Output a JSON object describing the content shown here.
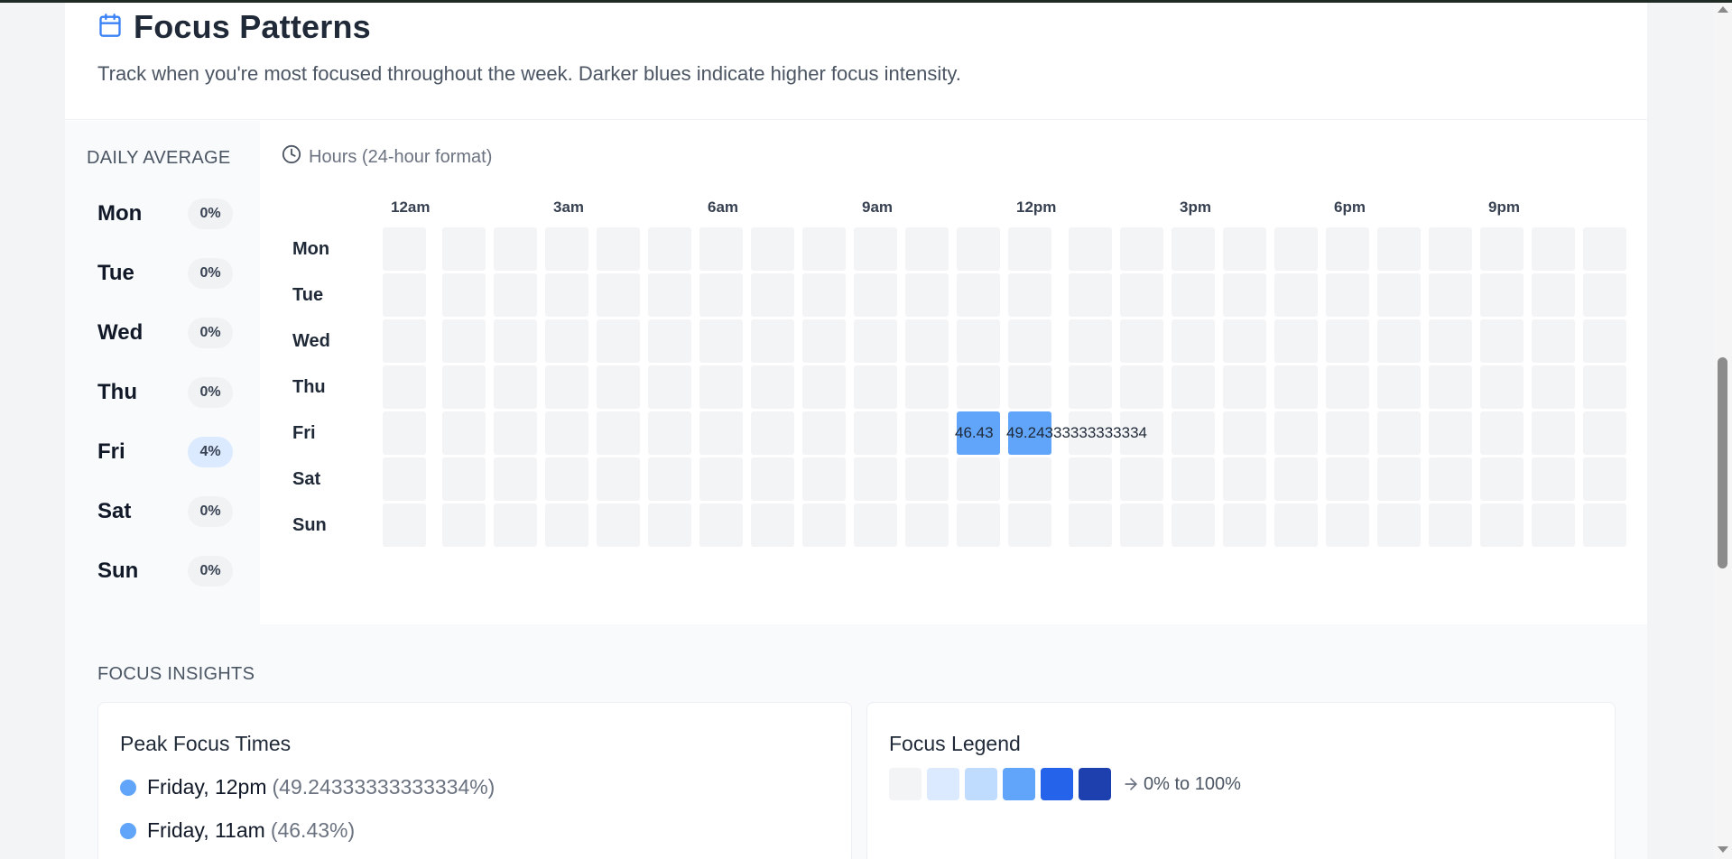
{
  "header": {
    "title": "Focus Patterns",
    "subtitle": "Track when you're most focused throughout the week. Darker blues indicate higher focus intensity.",
    "icon": "calendar-icon"
  },
  "sidebar": {
    "heading": "DAILY AVERAGE",
    "days": [
      {
        "name": "Mon",
        "pct": "0%"
      },
      {
        "name": "Tue",
        "pct": "0%"
      },
      {
        "name": "Wed",
        "pct": "0%"
      },
      {
        "name": "Thu",
        "pct": "0%"
      },
      {
        "name": "Fri",
        "pct": "4%"
      },
      {
        "name": "Sat",
        "pct": "0%"
      },
      {
        "name": "Sun",
        "pct": "0%"
      }
    ]
  },
  "heatmap": {
    "hours_label": "Hours (24-hour format)",
    "hour_ticks": [
      "12am",
      "3am",
      "6am",
      "9am",
      "12pm",
      "3pm",
      "6pm",
      "9pm"
    ],
    "rows": [
      "Mon",
      "Tue",
      "Wed",
      "Thu",
      "Fri",
      "Sat",
      "Sun"
    ],
    "hours_per_row": 24,
    "active_cells": [
      {
        "day": "Fri",
        "hour": 11,
        "value": 46.43,
        "label": "46.43"
      },
      {
        "day": "Fri",
        "hour": 12,
        "value": 49.24333333333334,
        "label": "49.24333333333334"
      }
    ],
    "colors": {
      "empty": "#f3f4f6",
      "active": "#60a5fa"
    }
  },
  "insights": {
    "heading": "FOCUS INSIGHTS",
    "peak": {
      "title": "Peak Focus Times",
      "items": [
        {
          "label": "Friday, 12pm",
          "value": "(49.24333333333334%)"
        },
        {
          "label": "Friday, 11am",
          "value": "(46.43%)"
        }
      ]
    },
    "legend": {
      "title": "Focus Legend",
      "colors": [
        "#f3f4f6",
        "#dbeafe",
        "#bfdbfe",
        "#60a5fa",
        "#2563eb",
        "#1e40af"
      ],
      "range_text": "0% to 100%"
    }
  }
}
